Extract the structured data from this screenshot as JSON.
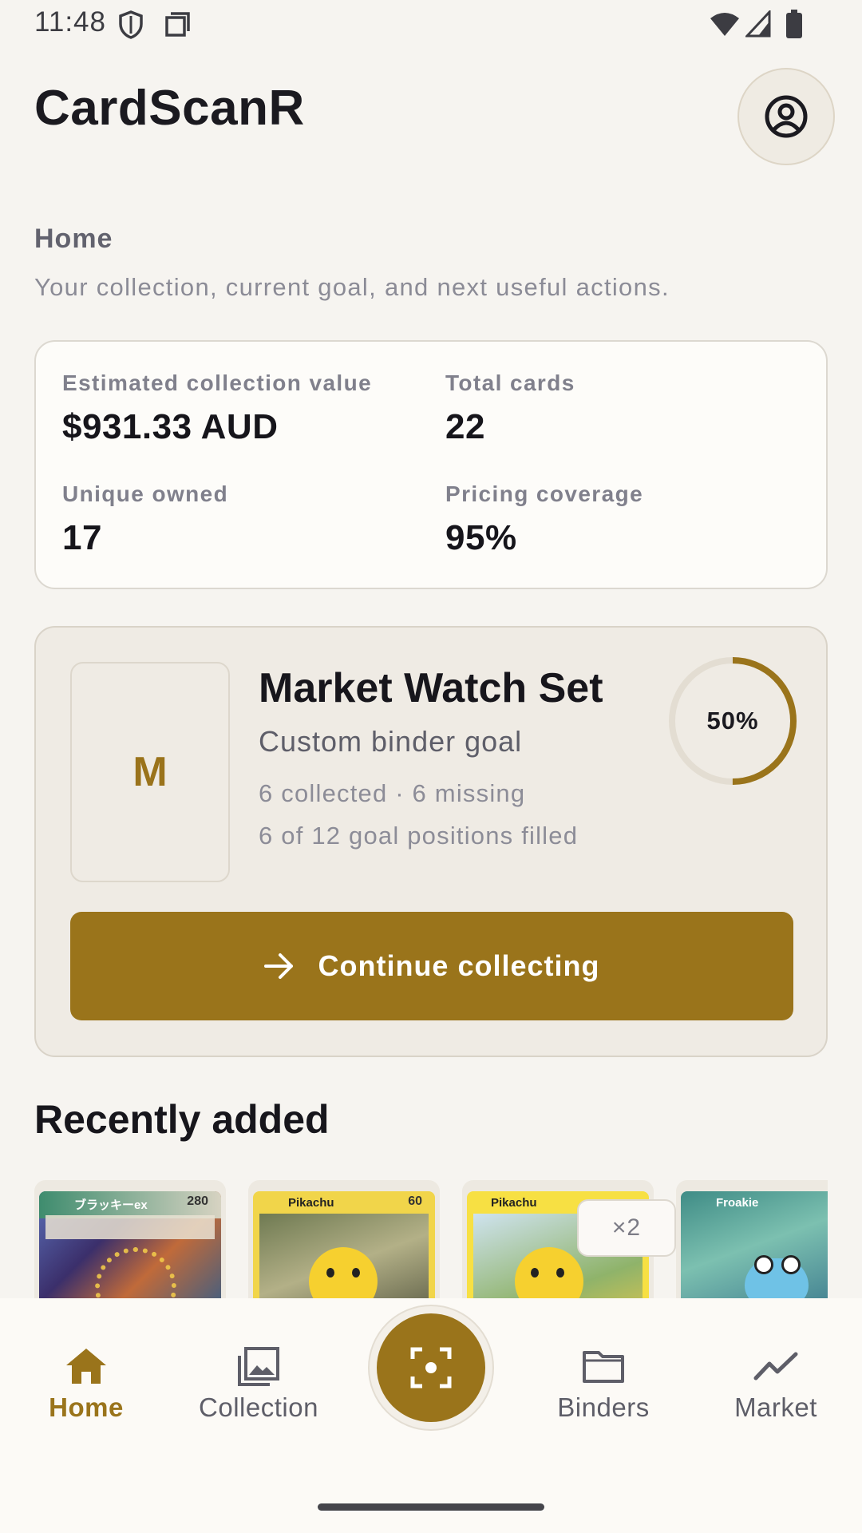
{
  "status_bar": {
    "time": "11:48",
    "icons": [
      "shield-icon",
      "sim-card-icon",
      "wifi-icon",
      "cell-signal-icon",
      "battery-icon"
    ]
  },
  "app": {
    "title": "CardScanR",
    "profile_icon": "account-circle-icon"
  },
  "page": {
    "heading": "Home",
    "subtitle": "Your collection, current goal, and next useful actions."
  },
  "stats": [
    {
      "label": "Estimated collection value",
      "value": "$931.33 AUD"
    },
    {
      "label": "Total cards",
      "value": "22"
    },
    {
      "label": "Unique owned",
      "value": "17"
    },
    {
      "label": "Pricing coverage",
      "value": "95%"
    }
  ],
  "goal": {
    "thumb_letter": "M",
    "title": "Market Watch Set",
    "subtitle": "Custom binder goal",
    "collected_line": "6 collected · 6 missing",
    "positions_line": "6 of 12 goal positions filled",
    "progress_label": "50%",
    "progress_fraction": 0.5,
    "button_label": "Continue collecting",
    "button_icon": "arrow-right-icon"
  },
  "recent": {
    "heading": "Recently added",
    "cards": [
      {
        "name": "ブラッキーex",
        "hp": "280",
        "art": "umbreon-ex"
      },
      {
        "name": "Pikachu",
        "hp": "60",
        "art": "pikachu"
      },
      {
        "name": "Pikachu",
        "hp": "",
        "art": "pikachu",
        "quantity": "×2"
      },
      {
        "name": "Froakie",
        "hp": "",
        "art": "froakie"
      }
    ]
  },
  "nav": {
    "items": [
      {
        "label": "Home",
        "icon": "home-icon",
        "active": true
      },
      {
        "label": "Collection",
        "icon": "image-stack-icon",
        "active": false
      },
      {
        "label": "Binders",
        "icon": "folder-icon",
        "active": false
      },
      {
        "label": "Market",
        "icon": "trend-line-icon",
        "active": false
      }
    ],
    "scan_icon": "scan-frame-icon"
  },
  "colors": {
    "accent": "#9a741b",
    "background": "#f6f4f0",
    "card_background": "#fdfcf9",
    "goal_background": "#efebe4"
  }
}
